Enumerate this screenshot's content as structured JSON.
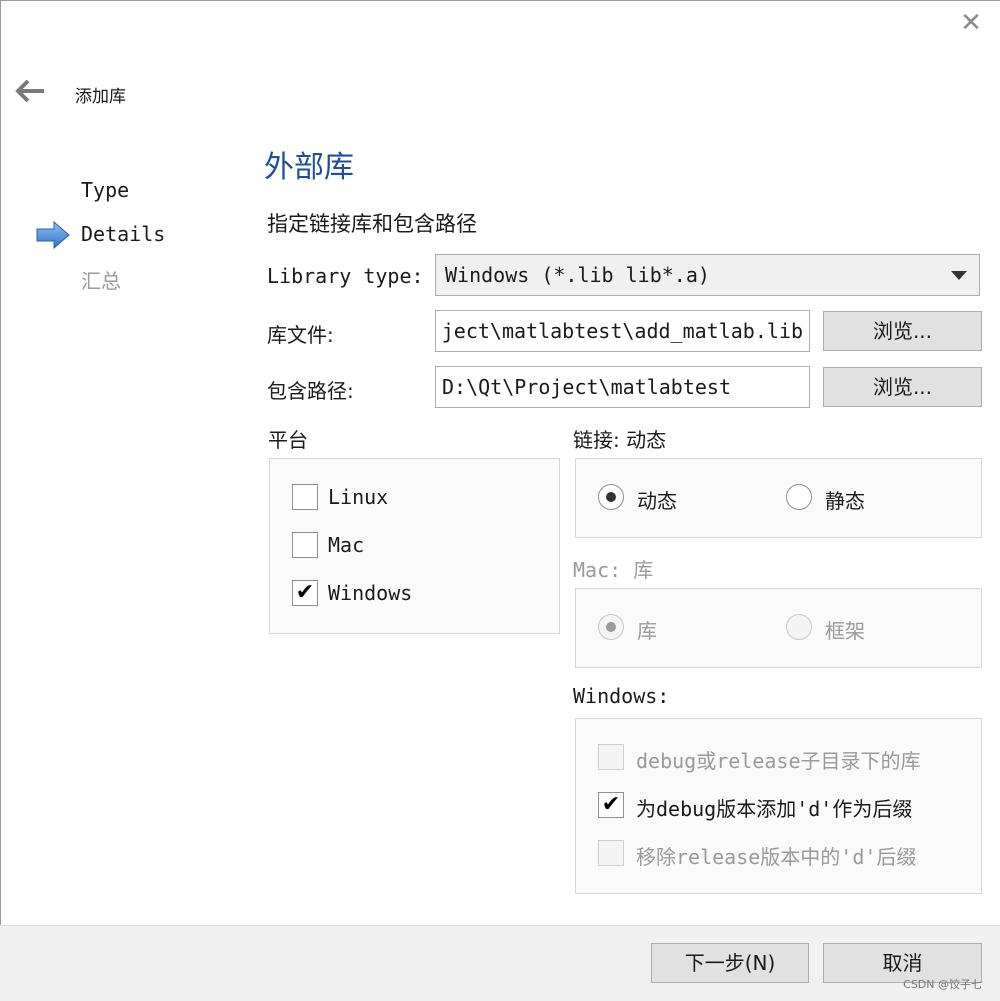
{
  "window": {
    "close_glyph": "✕"
  },
  "wizard": {
    "title": "添加库",
    "steps": [
      {
        "label": "Type",
        "state": "done"
      },
      {
        "label": "Details",
        "state": "current"
      },
      {
        "label": "汇总",
        "state": "pending"
      }
    ]
  },
  "page": {
    "title": "外部库",
    "subtitle": "指定链接库和包含路径",
    "library_type": {
      "label": "Library type:",
      "value": "Windows (*.lib lib*.a)"
    },
    "library_file": {
      "label": "库文件:",
      "value": "D:\\Qt\\Project\\matlabtest\\add_matlab.lib",
      "browse": "浏览..."
    },
    "include_path": {
      "label": "包含路径:",
      "value": "D:\\Qt\\Project\\matlabtest",
      "browse": "浏览..."
    },
    "platform": {
      "label": "平台",
      "options": [
        {
          "label": "Linux",
          "checked": false
        },
        {
          "label": "Mac",
          "checked": false
        },
        {
          "label": "Windows",
          "checked": true
        }
      ]
    },
    "linkage": {
      "label": "链接: 动态",
      "options": [
        {
          "label": "动态",
          "selected": true
        },
        {
          "label": "静态",
          "selected": false
        }
      ]
    },
    "mac": {
      "label": "Mac: 库",
      "options": [
        {
          "label": "库",
          "selected": true,
          "enabled": false
        },
        {
          "label": "框架",
          "selected": false,
          "enabled": false
        }
      ]
    },
    "windows": {
      "label": "Windows:",
      "options": [
        {
          "label": "debug或release子目录下的库",
          "checked": false,
          "enabled": false
        },
        {
          "label": "为debug版本添加'd'作为后缀",
          "checked": true,
          "enabled": true
        },
        {
          "label": "移除release版本中的'd'后缀",
          "checked": false,
          "enabled": false
        }
      ]
    }
  },
  "footer": {
    "next": "下一步(N)",
    "cancel": "取消"
  },
  "watermark": "CSDN @饺子七",
  "colors": {
    "title_blue": "#1f4e9c",
    "step_arrow": "#3b7fd4"
  },
  "icons": {
    "back": "back-arrow-icon",
    "step": "current-step-arrow-icon",
    "check": "✔"
  }
}
